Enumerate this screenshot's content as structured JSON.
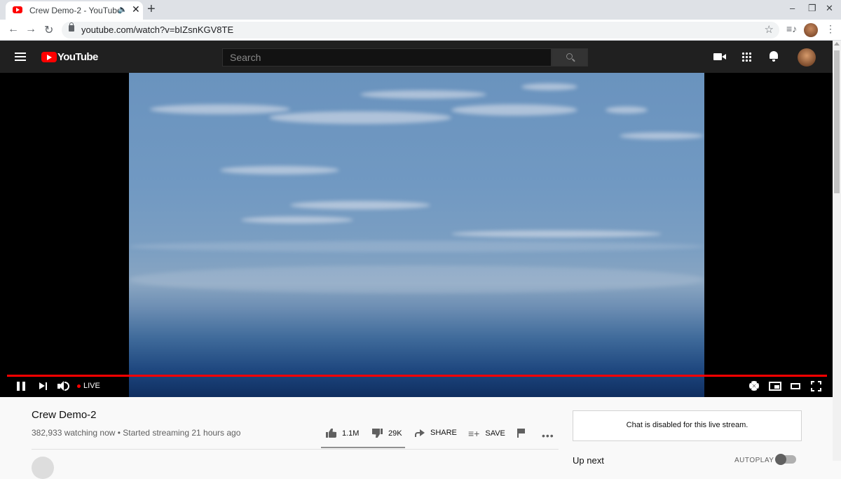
{
  "browser": {
    "tab_title": "Crew Demo-2 - YouTube",
    "tab_audio_icon": "speaker-icon",
    "new_tab_label": "+",
    "url": "youtube.com/watch?v=bIZsnKGV8TE",
    "window_controls": [
      "–",
      "❐",
      "✕"
    ]
  },
  "youtube_header": {
    "logo_text": "YouTube",
    "search_placeholder": "Search"
  },
  "player": {
    "live_label": "LIVE",
    "progress_fraction": 1.0,
    "accent_color": "#ff0000"
  },
  "video": {
    "title": "Crew Demo-2",
    "view_info": "382,933 watching now • Started streaming 21 hours ago",
    "likes": "1.1M",
    "dislikes": "29K",
    "share_label": "SHARE",
    "save_label": "SAVE",
    "more_label": "•••"
  },
  "sidebar": {
    "chat_message": "Chat is disabled for this live stream.",
    "up_next_label": "Up next",
    "autoplay_label": "AUTOPLAY"
  }
}
